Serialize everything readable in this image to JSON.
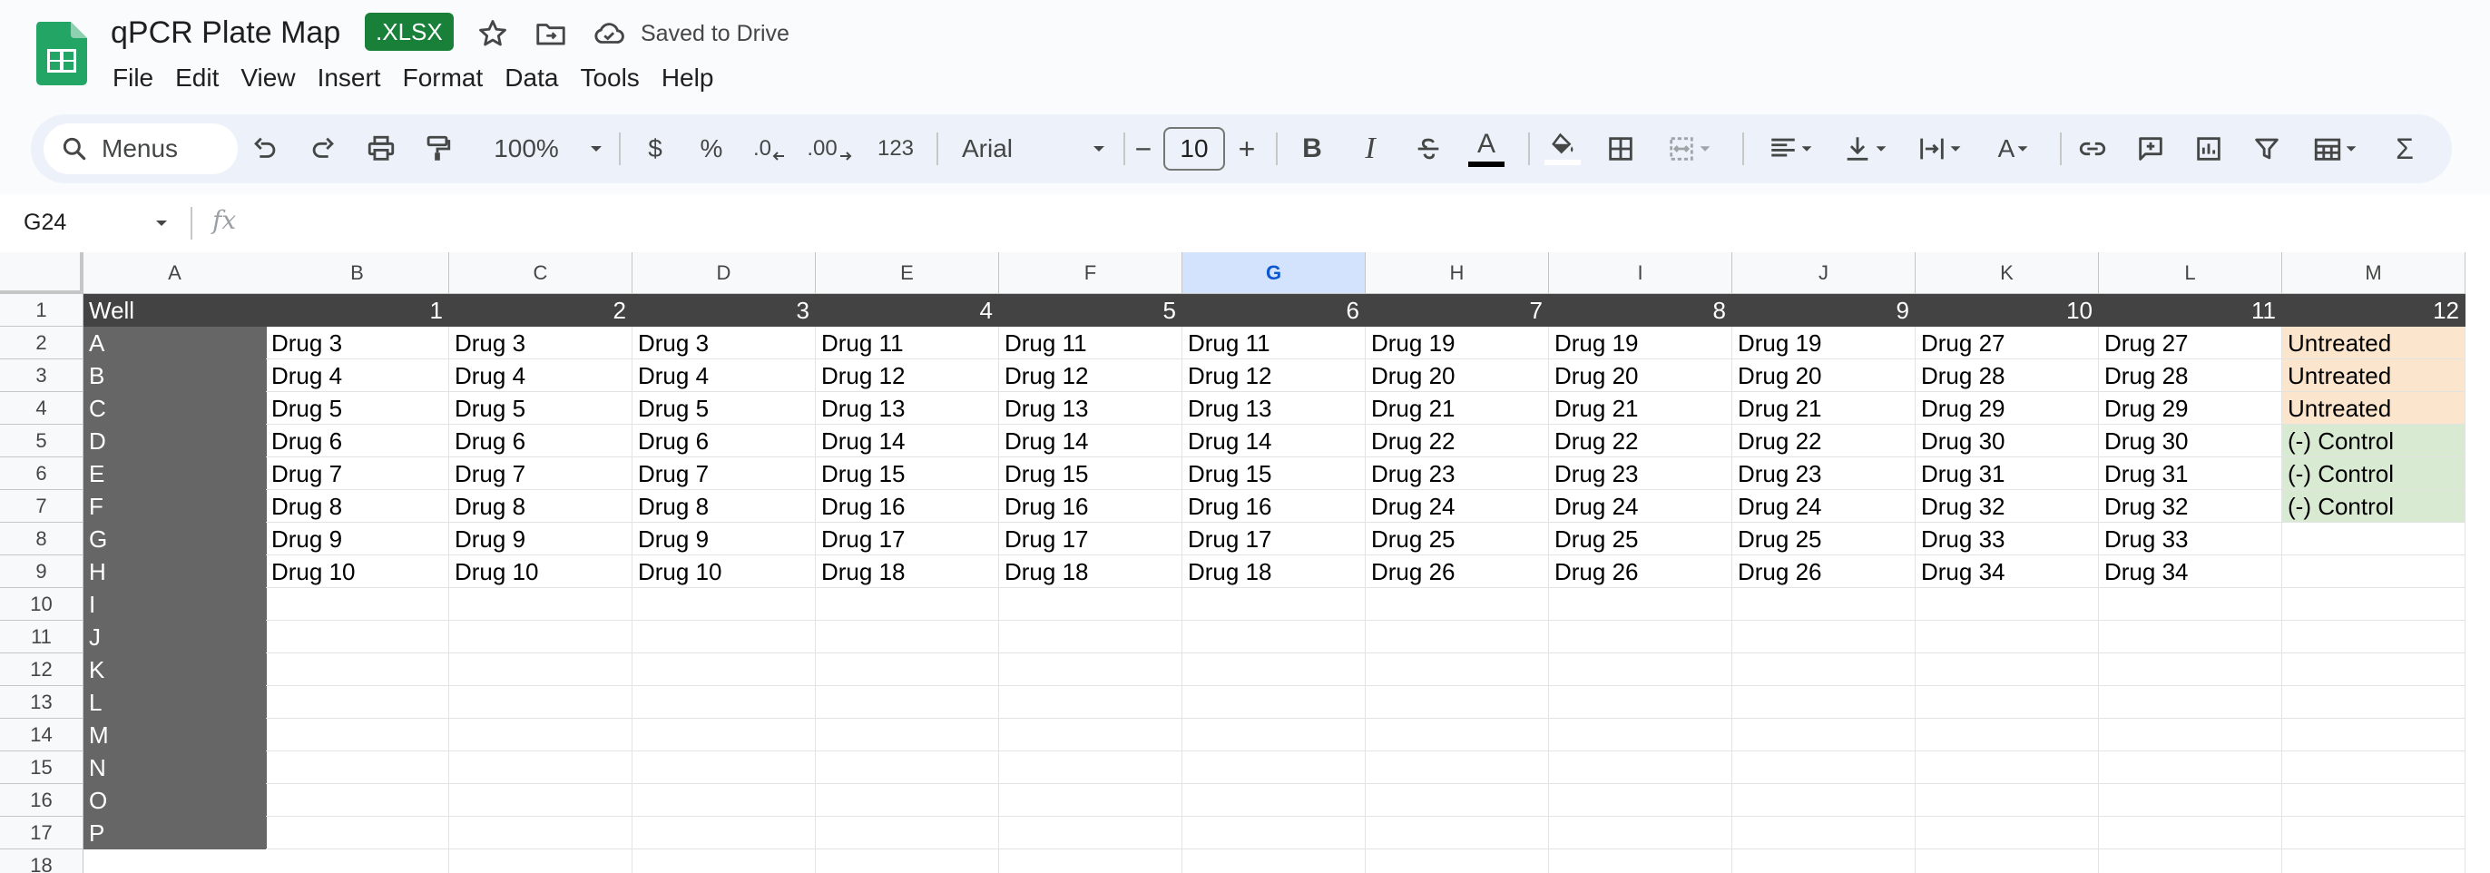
{
  "app": {
    "doc_title": "qPCR Plate Map",
    "file_badge": ".XLSX",
    "save_status": "Saved to Drive",
    "icons": [
      "sheets-logo-icon",
      "star-icon",
      "move-folder-icon",
      "cloud-saved-icon"
    ],
    "menu": [
      "File",
      "Edit",
      "View",
      "Insert",
      "Format",
      "Data",
      "Tools",
      "Help"
    ]
  },
  "toolbar": {
    "menus_label": "Menus",
    "zoom": "100%",
    "currency": "$",
    "percent": "%",
    "decrease_decimal": ".0",
    "increase_decimal": ".00",
    "more_formats": "123",
    "font_name": "Arial",
    "font_size": "10",
    "minus": "−",
    "plus": "+",
    "bold": "B",
    "italic": "I",
    "text_color_letter": "A",
    "text_rotation_letter": "A",
    "sum": "Σ"
  },
  "formula_bar": {
    "cell_ref": "G24",
    "fx": "fx",
    "value": ""
  },
  "sheet": {
    "selected_column": "G",
    "columns": [
      "A",
      "B",
      "C",
      "D",
      "E",
      "F",
      "G",
      "H",
      "I",
      "J",
      "K",
      "L",
      "M"
    ],
    "row_numbers": [
      "1",
      "2",
      "3",
      "4",
      "5",
      "6",
      "7",
      "8",
      "9",
      "10",
      "11",
      "12",
      "13",
      "14",
      "15",
      "16",
      "17",
      "18"
    ],
    "header_row": [
      "Well",
      "1",
      "2",
      "3",
      "4",
      "5",
      "6",
      "7",
      "8",
      "9",
      "10",
      "11",
      "12"
    ],
    "well_rows": [
      "A",
      "B",
      "C",
      "D",
      "E",
      "F",
      "G",
      "H",
      "I",
      "J",
      "K",
      "L",
      "M",
      "N",
      "O",
      "P"
    ],
    "data_rows": [
      [
        "Drug 3",
        "Drug 3",
        "Drug 3",
        "Drug 11",
        "Drug 11",
        "Drug 11",
        "Drug 19",
        "Drug 19",
        "Drug 19",
        "Drug 27",
        "Drug 27",
        "Untreated"
      ],
      [
        "Drug 4",
        "Drug 4",
        "Drug 4",
        "Drug 12",
        "Drug 12",
        "Drug 12",
        "Drug 20",
        "Drug 20",
        "Drug 20",
        "Drug 28",
        "Drug 28",
        "Untreated"
      ],
      [
        "Drug 5",
        "Drug 5",
        "Drug 5",
        "Drug 13",
        "Drug 13",
        "Drug 13",
        "Drug 21",
        "Drug 21",
        "Drug 21",
        "Drug 29",
        "Drug 29",
        "Untreated"
      ],
      [
        "Drug 6",
        "Drug 6",
        "Drug 6",
        "Drug 14",
        "Drug 14",
        "Drug 14",
        "Drug 22",
        "Drug 22",
        "Drug 22",
        "Drug 30",
        "Drug 30",
        "(-) Control"
      ],
      [
        "Drug 7",
        "Drug 7",
        "Drug 7",
        "Drug 15",
        "Drug 15",
        "Drug 15",
        "Drug 23",
        "Drug 23",
        "Drug 23",
        "Drug 31",
        "Drug 31",
        "(-) Control"
      ],
      [
        "Drug 8",
        "Drug 8",
        "Drug 8",
        "Drug 16",
        "Drug 16",
        "Drug 16",
        "Drug 24",
        "Drug 24",
        "Drug 24",
        "Drug 32",
        "Drug 32",
        "(-) Control"
      ],
      [
        "Drug 9",
        "Drug 9",
        "Drug 9",
        "Drug 17",
        "Drug 17",
        "Drug 17",
        "Drug 25",
        "Drug 25",
        "Drug 25",
        "Drug 33",
        "Drug 33",
        ""
      ],
      [
        "Drug 10",
        "Drug 10",
        "Drug 10",
        "Drug 18",
        "Drug 18",
        "Drug 18",
        "Drug 26",
        "Drug 26",
        "Drug 26",
        "Drug 34",
        "Drug 34",
        ""
      ]
    ],
    "colors": {
      "header_bg": "#434343",
      "well_bg": "#666666",
      "untreated_bg": "#fce5cd",
      "control_bg": "#d9ead3",
      "selected_header_bg": "#d3e3fd",
      "brand_green": "#188038"
    }
  }
}
